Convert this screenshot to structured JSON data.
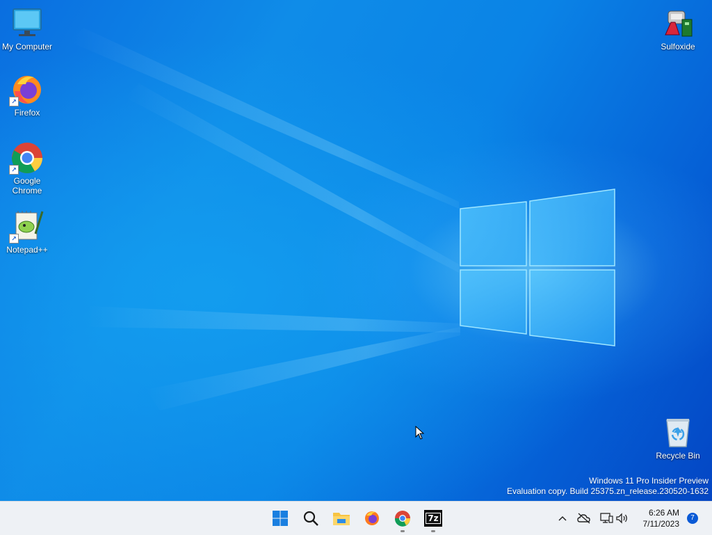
{
  "desktop": {
    "icons_left": [
      {
        "label": "My Computer"
      },
      {
        "label": "Firefox"
      },
      {
        "label": "Google Chrome"
      },
      {
        "label": "Notepad++"
      }
    ],
    "icons_right": [
      {
        "label": "Sulfoxide"
      },
      {
        "label": "Recycle Bin"
      }
    ],
    "watermark": {
      "line1": "Windows 11 Pro Insider Preview",
      "line2": "Evaluation copy. Build 25375.zn_release.230520-1632"
    }
  },
  "taskbar": {
    "apps": [
      {
        "icon": "windows-start-icon",
        "running": false
      },
      {
        "icon": "search-icon",
        "running": false
      },
      {
        "icon": "file-explorer-icon",
        "running": false
      },
      {
        "icon": "firefox-icon",
        "running": false
      },
      {
        "icon": "chrome-icon",
        "running": true
      },
      {
        "icon": "7zip-icon",
        "running": true
      }
    ],
    "seven_zip_label": "7z",
    "tray": {
      "time": "6:26 AM",
      "date": "7/11/2023",
      "notification_count": "7",
      "icons": [
        "chevron-up-icon",
        "onedrive-offline-icon",
        "network-icon",
        "volume-icon"
      ]
    }
  },
  "colors": {
    "accent": "#0a5ad6",
    "taskbar_bg": "#eef1f5",
    "desktop_blue": "#0a83e6"
  }
}
